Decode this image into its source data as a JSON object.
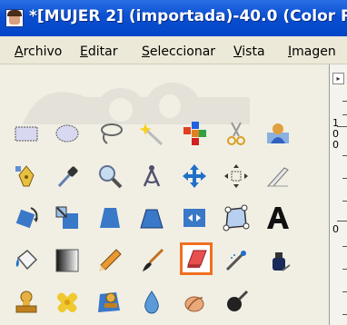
{
  "window": {
    "title": "*[MUJER 2] (importada)-40.0 (Color R"
  },
  "menu": {
    "items": [
      {
        "pre": "",
        "key": "A",
        "rest": "rchivo"
      },
      {
        "pre": "",
        "key": "E",
        "rest": "ditar"
      },
      {
        "pre": "",
        "key": "S",
        "rest": "eleccionar"
      },
      {
        "pre": "",
        "key": "V",
        "rest": "ista"
      },
      {
        "pre": "",
        "key": "I",
        "rest": "magen"
      }
    ]
  },
  "ruler": {
    "labels": [
      "1",
      "0",
      "0",
      "0"
    ]
  },
  "toolbox": {
    "active_tool": "eraser",
    "accent": "#f07020",
    "tools": [
      "rect-select",
      "ellipse-select",
      "free-select",
      "fuzzy-select",
      "color-select",
      "scissors",
      "foreground-select",
      "paths",
      "color-picker",
      "zoom",
      "measure",
      "move",
      "align",
      "crop",
      "rotate",
      "scale",
      "shear",
      "perspective",
      "flip",
      "cage-transform",
      "text",
      "bucket-fill",
      "blend",
      "pencil",
      "paintbrush",
      "eraser",
      "airbrush",
      "ink",
      "clone",
      "heal",
      "perspective-clone",
      "blur",
      "smudge",
      "dodge-burn"
    ]
  }
}
